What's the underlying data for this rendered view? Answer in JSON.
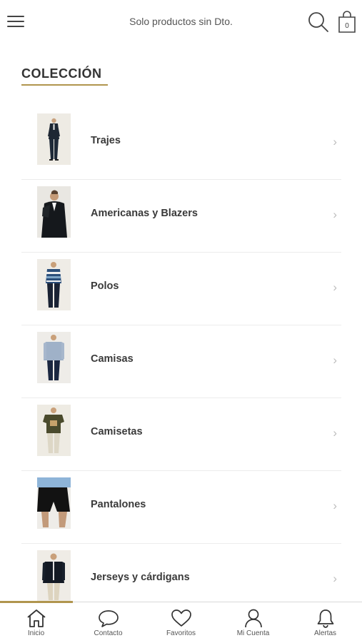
{
  "header": {
    "title": "Solo productos sin Dto.",
    "icons": [
      "menu-icon",
      "search-icon",
      "shopping-bag-icon"
    ],
    "bag_count": "0"
  },
  "section": {
    "title": "COLECCIÓN"
  },
  "categories": [
    {
      "label": "Trajes",
      "image": "suit-photo"
    },
    {
      "label": "Americanas y Blazers",
      "image": "blazer-photo"
    },
    {
      "label": "Polos",
      "image": "polo-photo"
    },
    {
      "label": "Camisas",
      "image": "shirt-photo"
    },
    {
      "label": "Camisetas",
      "image": "tshirt-photo"
    },
    {
      "label": "Pantalones",
      "image": "shorts-photo"
    },
    {
      "label": "Jerseys y cárdigans",
      "image": "sweater-photo"
    }
  ],
  "tabs": [
    {
      "label": "Inicio",
      "icon": "home-icon",
      "active": true
    },
    {
      "label": "Contacto",
      "icon": "chat-icon",
      "active": false
    },
    {
      "label": "Favoritos",
      "icon": "heart-icon",
      "active": false
    },
    {
      "label": "Mi Cuenta",
      "icon": "user-icon",
      "active": false
    },
    {
      "label": "Alertas",
      "icon": "bell-icon",
      "active": false
    }
  ],
  "colors": {
    "accent": "#b0954e",
    "text": "#333333",
    "divider": "#ececec"
  }
}
